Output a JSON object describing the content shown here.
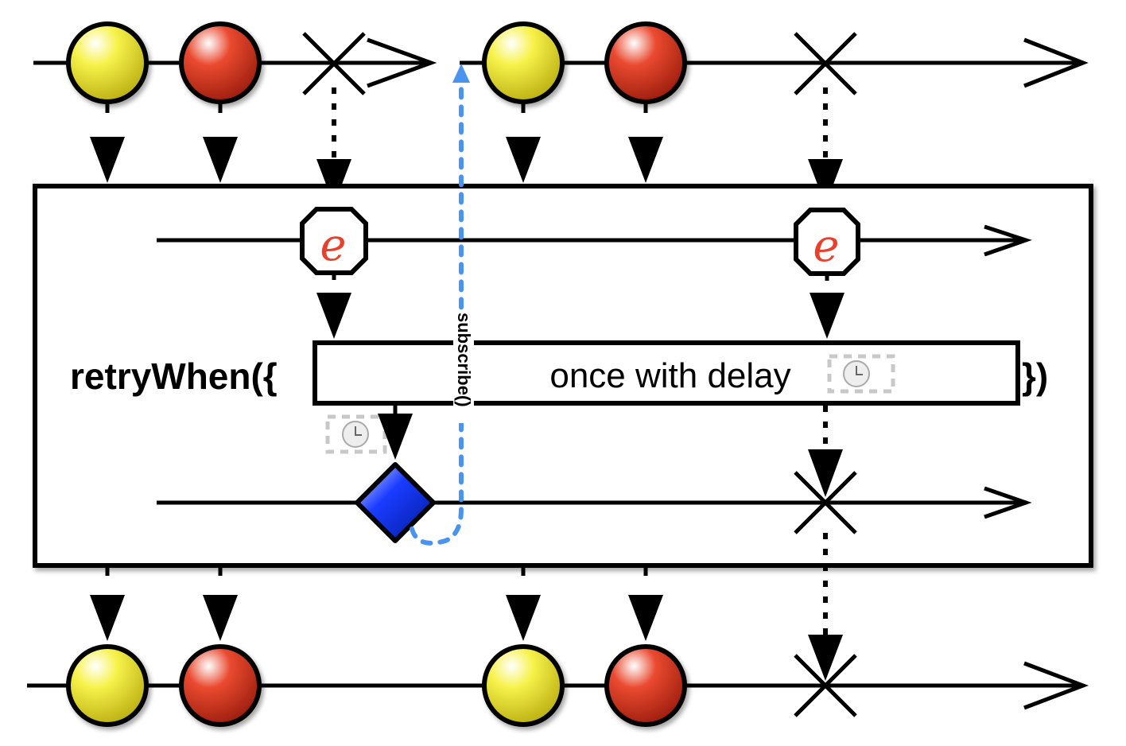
{
  "operator": {
    "prefix": "retryWhen({",
    "inner_label": "once with delay",
    "suffix": "})"
  },
  "error_symbol": "e",
  "resubscribe_label": "subscribe()",
  "colors": {
    "yellow_marble": "#f5ef3a",
    "red_marble": "#e8402a",
    "notifier_diamond": "#0a2ff0",
    "error_letter": "#e8402a",
    "resubscribe_path": "#4a94f0"
  },
  "icons": [
    "clock-icon",
    "error-octagon",
    "completion-x",
    "diamond-marble"
  ]
}
